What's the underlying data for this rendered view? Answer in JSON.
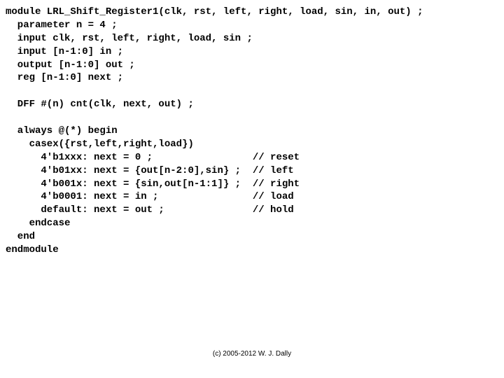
{
  "code": {
    "l1": "module LRL_Shift_Register1(clk, rst, left, right, load, sin, in, out) ;",
    "l2": "  parameter n = 4 ;",
    "l3": "  input clk, rst, left, right, load, sin ;",
    "l4": "  input [n-1:0] in ;",
    "l5": "  output [n-1:0] out ;",
    "l6": "  reg [n-1:0] next ;",
    "l7": "",
    "l8": "  DFF #(n) cnt(clk, next, out) ;",
    "l9": "",
    "l10": "  always @(*) begin",
    "l11": "    casex({rst,left,right,load})",
    "l12": "      4'b1xxx: next = 0 ;                 // reset",
    "l13": "      4'b01xx: next = {out[n-2:0],sin} ;  // left",
    "l14": "      4'b001x: next = {sin,out[n-1:1]} ;  // right",
    "l15": "      4'b0001: next = in ;                // load",
    "l16": "      default: next = out ;               // hold",
    "l17": "    endcase",
    "l18": "  end",
    "l19": "endmodule"
  },
  "footer": "(c) 2005-2012 W. J. Dally"
}
